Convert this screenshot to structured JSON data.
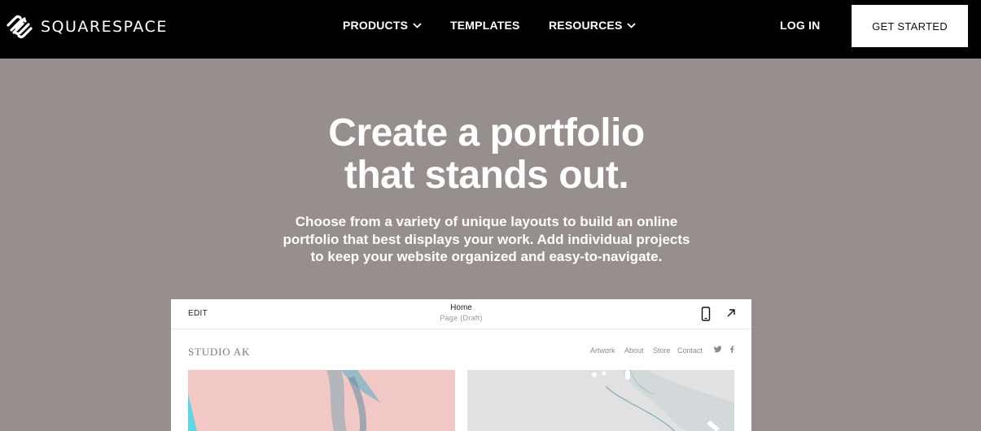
{
  "brand": {
    "logo_text": "SQUARESPACE",
    "logo_icon": "squarespace-logo-icon"
  },
  "nav": {
    "products": "PRODUCTS",
    "templates": "TEMPLATES",
    "resources": "RESOURCES",
    "login": "LOG IN",
    "get_started": "GET STARTED"
  },
  "hero": {
    "title_line1": "Create a portfolio",
    "title_line2": "that stands out.",
    "subtitle_line1": "Choose from a variety of unique layouts to build an online",
    "subtitle_line2": "portfolio that best displays your work. Add individual projects",
    "subtitle_line3": "to keep your website organized and easy-to-navigate."
  },
  "editor": {
    "edit_label": "EDIT",
    "page_name": "Home",
    "page_status": "Page (Draft)",
    "icons": [
      "mobile-preview-icon",
      "open-external-icon"
    ]
  },
  "site_preview": {
    "logo": "STUDIO AK",
    "nav": [
      "Artwork",
      "About",
      "Store",
      "Contact"
    ],
    "social_icons": [
      "twitter-icon",
      "facebook-icon"
    ],
    "colors": {
      "image1_bg": "#f2c8c7",
      "image1_accent": "#5fd5e6",
      "image2_bg": "#e1e1e1"
    }
  },
  "colors": {
    "nav_bg": "#000000",
    "hero_bg": "#978f8d",
    "cta_bg": "#ffffff"
  }
}
